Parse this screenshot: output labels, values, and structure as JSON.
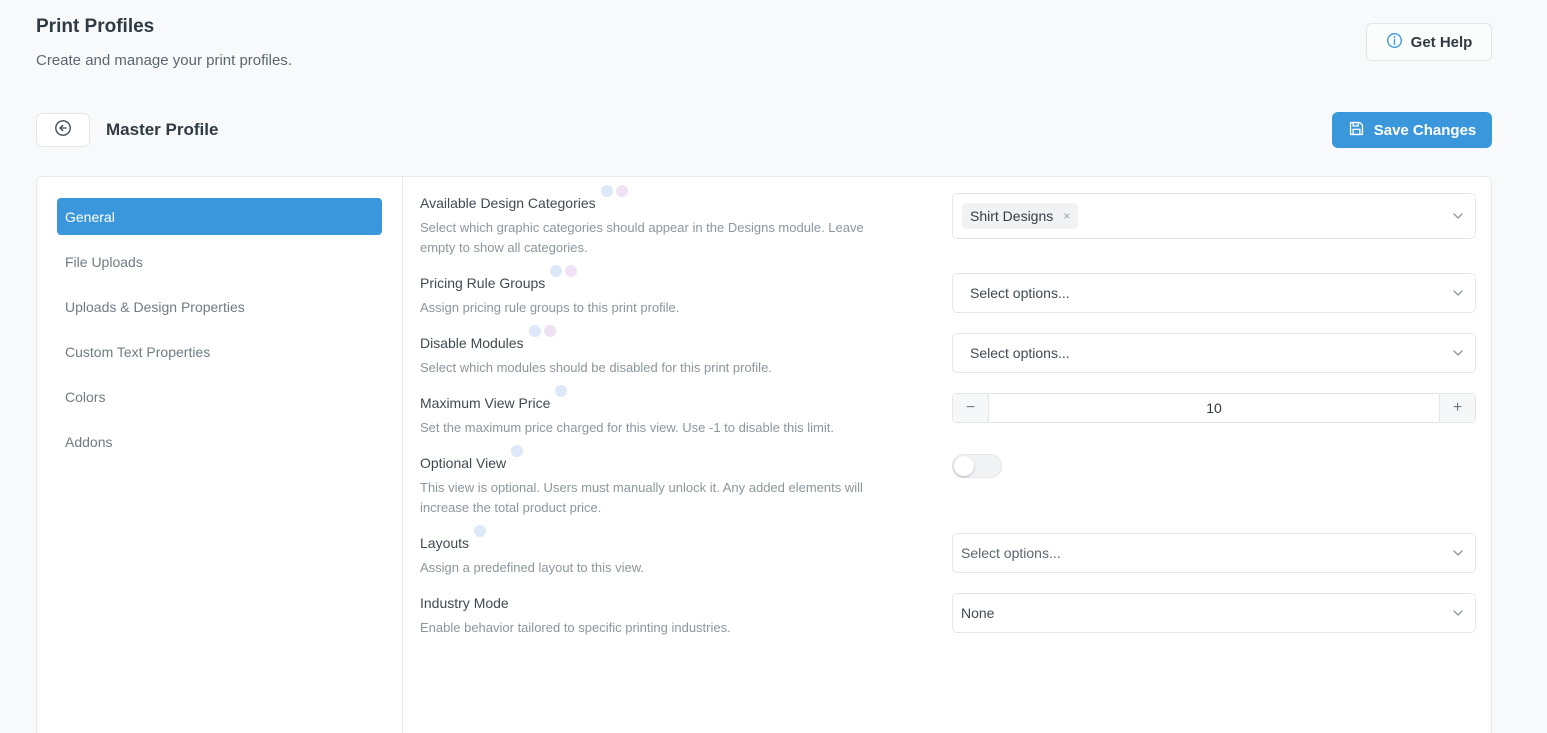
{
  "header": {
    "title": "Print Profiles",
    "subtitle": "Create and manage your print profiles.",
    "help_label": "Get Help"
  },
  "profile": {
    "name": "Master Profile",
    "save_label": "Save Changes"
  },
  "sidebar": {
    "items": [
      {
        "label": "General",
        "active": true
      },
      {
        "label": "File Uploads",
        "active": false
      },
      {
        "label": "Uploads & Design Properties",
        "active": false
      },
      {
        "label": "Custom Text Properties",
        "active": false
      },
      {
        "label": "Colors",
        "active": false
      },
      {
        "label": "Addons",
        "active": false
      }
    ]
  },
  "settings": {
    "design_categories": {
      "label": "Available Design Categories",
      "description": "Select which graphic categories should appear in the Designs module. Leave empty to show all categories.",
      "selected": [
        "Shirt Designs"
      ],
      "remove_icon": "×"
    },
    "pricing_rule_groups": {
      "label": "Pricing Rule Groups",
      "description": "Assign pricing rule groups to this print profile.",
      "placeholder": "Select options..."
    },
    "disable_modules": {
      "label": "Disable Modules",
      "description": "Select which modules should be disabled for this print profile.",
      "placeholder": "Select options..."
    },
    "max_view_price": {
      "label": "Maximum View Price",
      "description": "Set the maximum price charged for this view. Use -1 to disable this limit.",
      "value": "10",
      "minus": "−",
      "plus": "+"
    },
    "optional_view": {
      "label": "Optional View",
      "description": "This view is optional. Users must manually unlock it. Any added elements will increase the total product price.",
      "enabled": false
    },
    "layouts": {
      "label": "Layouts",
      "description": "Assign a predefined layout to this view.",
      "placeholder": "Select options..."
    },
    "industry_mode": {
      "label": "Industry Mode",
      "description": "Enable behavior tailored to specific printing industries.",
      "value": "None"
    }
  },
  "colors": {
    "accent": "#3a97dc",
    "background": "#f8f9fa"
  },
  "icons": {
    "help": "info-circle-icon",
    "back": "arrow-left-circle-icon",
    "save": "floppy-disk-icon",
    "dropdown": "chevron-down-icon"
  }
}
